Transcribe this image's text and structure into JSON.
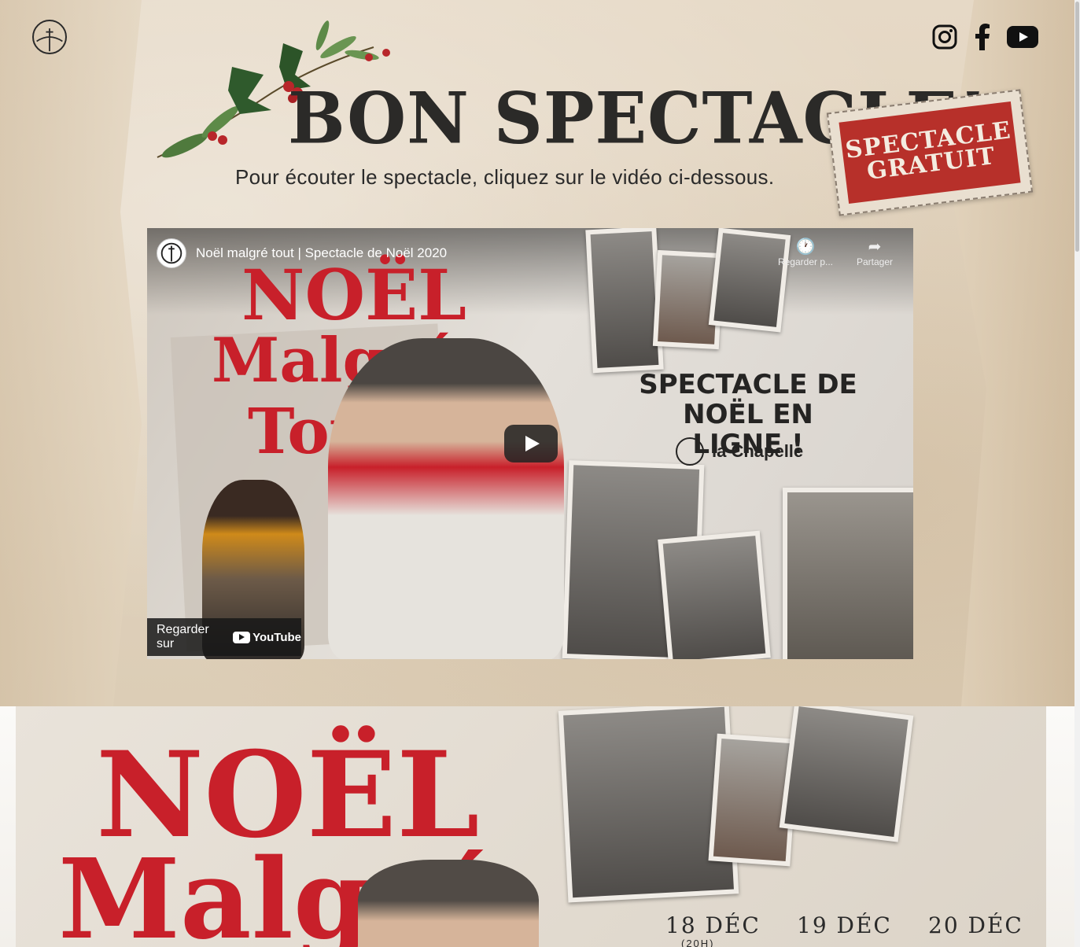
{
  "header": {
    "logo_label": "",
    "social": [
      {
        "name": "instagram-icon"
      },
      {
        "name": "facebook-icon"
      },
      {
        "name": "youtube-icon"
      }
    ]
  },
  "hero": {
    "title": "BON SPECTACLE!",
    "subtitle": "Pour écouter le spectacle, cliquez sur le vidéo ci-dessous.",
    "stamp_line1": "SPECTACLE",
    "stamp_line2": "GRATUIT"
  },
  "video": {
    "title": "Noël malgré tout | Spectacle de Noël 2020",
    "watch_later": "Regarder p...",
    "share": "Partager",
    "watch_on": "Regarder sur",
    "youtube_word": "YouTube",
    "poster_title_1": "NOËL",
    "poster_title_2": "Malgré",
    "poster_title_3": "Tout",
    "poster_tagline": "SPECTACLE DE NOËL EN LIGNE !",
    "poster_brand": "la Chapelle"
  },
  "section2": {
    "title_1": "NOËL",
    "title_2": "Malgré",
    "dates": [
      "18 DÉC",
      "19 DÉC",
      "20 DÉC"
    ],
    "date_sub": "(20H)"
  },
  "colors": {
    "accent_red": "#c8202a",
    "stamp_red": "#b7302a",
    "ink": "#2b2a28"
  }
}
